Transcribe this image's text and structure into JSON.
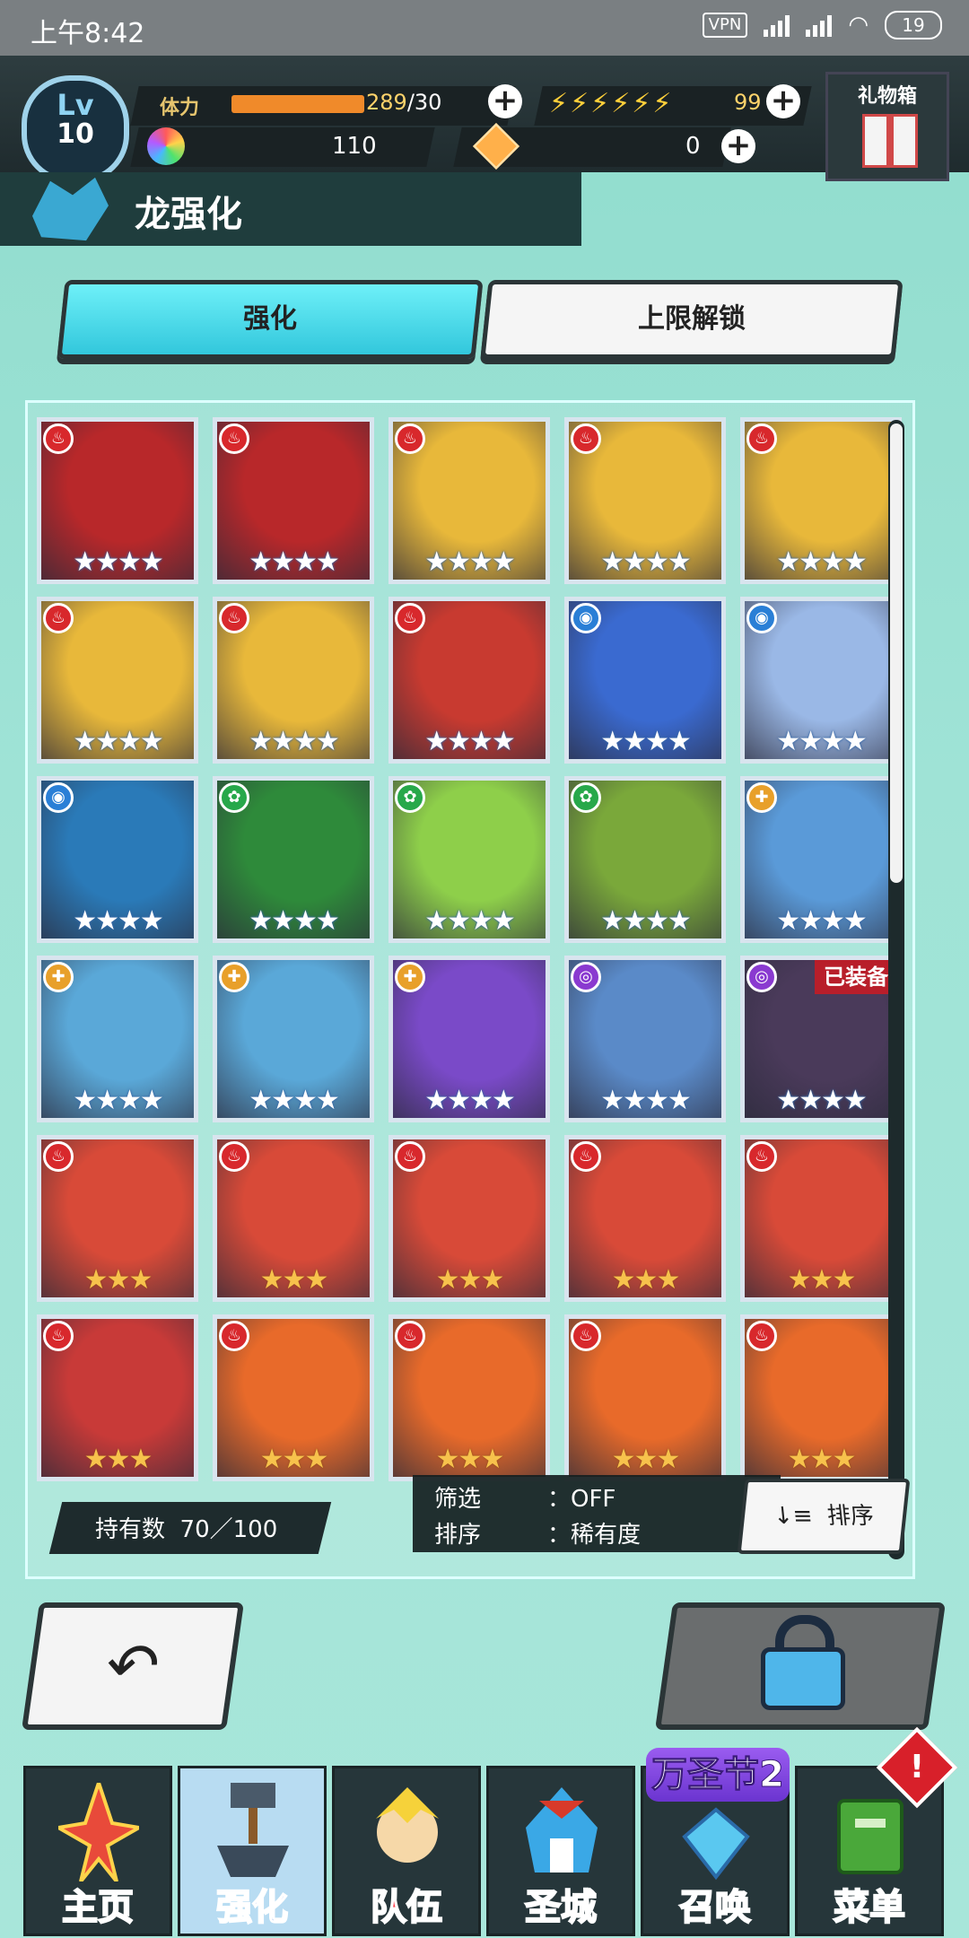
{
  "status_bar": {
    "time": "上午8:42",
    "vpn": "VPN",
    "battery": "19"
  },
  "player": {
    "level_label": "Lv",
    "level": "10",
    "stamina_label": "体力",
    "stamina_current": "289",
    "stamina_max": "/30",
    "stamina_fill": 1.0,
    "bolts": "⚡⚡⚡⚡⚡⚡",
    "bolt_count": "99",
    "orb_count": "110",
    "gem_count": "0",
    "gift_label": "礼物箱"
  },
  "page": {
    "title": "龙强化"
  },
  "tabs": [
    {
      "label": "强化",
      "active": true
    },
    {
      "label": "上限解锁",
      "active": false
    }
  ],
  "cards": [
    {
      "element": "fire",
      "stars": 4,
      "color": "#b8282a"
    },
    {
      "element": "fire",
      "stars": 4,
      "color": "#b8282a"
    },
    {
      "element": "fire",
      "stars": 4,
      "color": "#e8b83a"
    },
    {
      "element": "fire",
      "stars": 4,
      "color": "#e8b83a"
    },
    {
      "element": "fire",
      "stars": 4,
      "color": "#e8b83a"
    },
    {
      "element": "fire",
      "stars": 4,
      "color": "#e8b83a"
    },
    {
      "element": "fire",
      "stars": 4,
      "color": "#e8b83a"
    },
    {
      "element": "fire",
      "stars": 4,
      "color": "#c83a30"
    },
    {
      "element": "water",
      "stars": 4,
      "color": "#3a6ad0"
    },
    {
      "element": "water",
      "stars": 4,
      "color": "#9ab8e6"
    },
    {
      "element": "water",
      "stars": 4,
      "color": "#2a7ab8"
    },
    {
      "element": "wind",
      "stars": 4,
      "color": "#2e8a3a"
    },
    {
      "element": "wind",
      "stars": 4,
      "color": "#8ecf4a"
    },
    {
      "element": "wind",
      "stars": 4,
      "color": "#7aa83a"
    },
    {
      "element": "light",
      "stars": 4,
      "color": "#5a9ad8"
    },
    {
      "element": "light",
      "stars": 4,
      "color": "#5aa8d8"
    },
    {
      "element": "light",
      "stars": 4,
      "color": "#5aa8d8"
    },
    {
      "element": "light",
      "stars": 4,
      "color": "#7a4ac8"
    },
    {
      "element": "dark",
      "stars": 4,
      "color": "#5a8ac8"
    },
    {
      "element": "dark",
      "stars": 4,
      "color": "#4a3a5a",
      "equip": "已装备"
    },
    {
      "element": "fire",
      "stars": 3,
      "color": "#d84a38"
    },
    {
      "element": "fire",
      "stars": 3,
      "color": "#d84a38"
    },
    {
      "element": "fire",
      "stars": 3,
      "color": "#d84a38"
    },
    {
      "element": "fire",
      "stars": 3,
      "color": "#d84a38"
    },
    {
      "element": "fire",
      "stars": 3,
      "color": "#d84a38"
    },
    {
      "element": "fire",
      "stars": 3,
      "color": "#c83a38"
    },
    {
      "element": "fire",
      "stars": 3,
      "color": "#e86a2a"
    },
    {
      "element": "fire",
      "stars": 3,
      "color": "#e86a2a"
    },
    {
      "element": "fire",
      "stars": 3,
      "color": "#e86a2a"
    },
    {
      "element": "fire",
      "stars": 3,
      "color": "#e86a2a"
    }
  ],
  "holding": {
    "label": "持有数",
    "value": "70／100"
  },
  "filter": {
    "filter_label": "筛选",
    "filter_value": "：OFF",
    "sort_label": "排序",
    "sort_value": "：稀有度"
  },
  "sort_button": {
    "icon": "↓≡",
    "label": "排序"
  },
  "nav": [
    {
      "label": "主页",
      "icon": "home-icon"
    },
    {
      "label": "强化",
      "icon": "hammer-icon",
      "active": true
    },
    {
      "label": "队伍",
      "icon": "team-icon"
    },
    {
      "label": "圣城",
      "icon": "castle-icon"
    },
    {
      "label": "召唤",
      "icon": "summon-icon"
    },
    {
      "label": "菜单",
      "icon": "book-icon"
    }
  ],
  "event_tag": "万圣节2",
  "alert_mark": "!",
  "colors": {
    "tab_active": "#32c7dc",
    "accent_fire": "#d8282c",
    "accent_water": "#2a7fd6"
  }
}
